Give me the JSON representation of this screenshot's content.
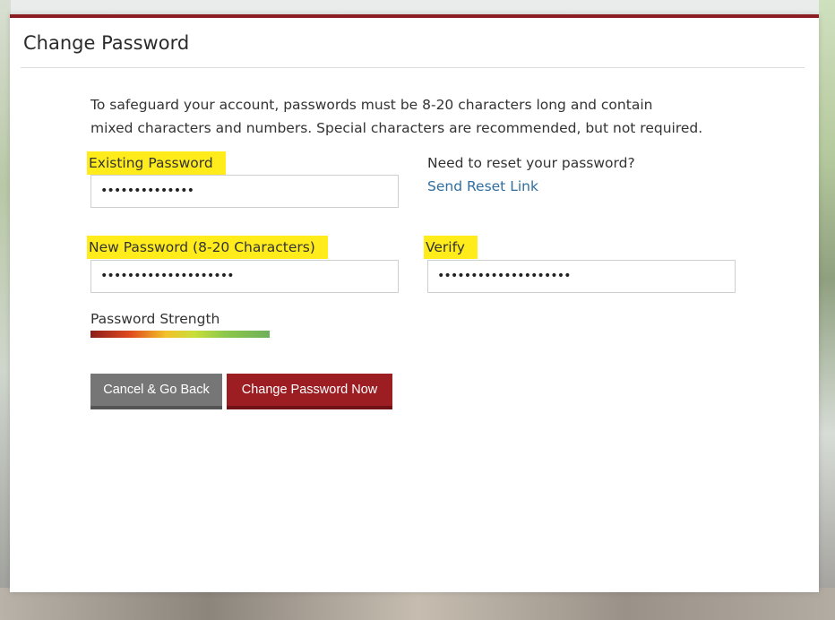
{
  "modal": {
    "title": "Change Password",
    "intro_line1": "To safeguard your account, passwords must be 8-20 characters long and contain",
    "intro_line2": "mixed characters and numbers. Special characters are recommended, but not required.",
    "existing": {
      "label": "Existing Password",
      "value": "••••••••••••••"
    },
    "reset": {
      "question": "Need to reset your password?",
      "link": "Send Reset Link"
    },
    "new_password": {
      "label": "New Password (8-20 Characters)",
      "value": "••••••••••••••••••••"
    },
    "verify": {
      "label": "Verify",
      "value": "••••••••••••••••••••"
    },
    "strength": {
      "label": "Password Strength"
    },
    "buttons": {
      "cancel": "Cancel & Go Back",
      "submit": "Change Password Now"
    },
    "colors": {
      "accent": "#8b1c22",
      "highlight": "#ffec1a",
      "link": "#2f6ea0",
      "cancel": "#767676"
    }
  }
}
